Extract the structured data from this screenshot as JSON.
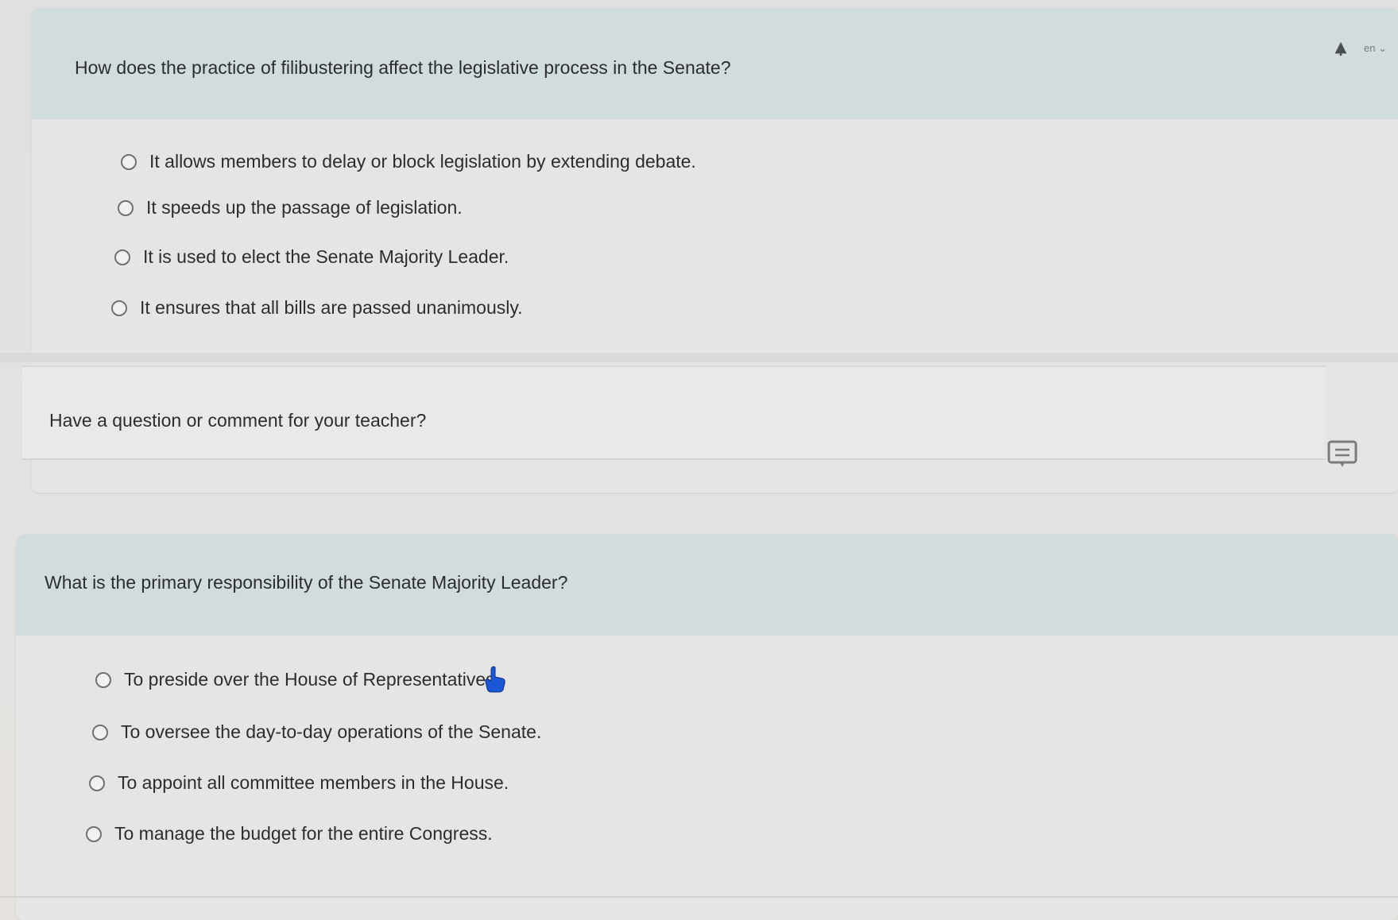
{
  "question1": {
    "text": "How does the practice of filibustering affect the legislative process in the Senate?",
    "options": [
      "It allows members to delay or block legislation by extending debate.",
      "It speeds up the passage of legislation.",
      "It is used to elect the Senate Majority Leader.",
      "It ensures that all bills are passed unanimously."
    ],
    "header_tools": {
      "alert_icon": "bell-icon",
      "language_label": "en"
    }
  },
  "comment": {
    "label": "Have a question or comment for your teacher?",
    "icon": "comment-icon"
  },
  "question2": {
    "text": "What is the primary responsibility of the Senate Majority Leader?",
    "options": [
      "To preside over the House of Representatives.",
      "To oversee the day-to-day operations of the Senate.",
      "To appoint all committee members in the House.",
      "To manage the budget for the entire Congress."
    ]
  },
  "cursor": {
    "icon": "hand-pointer-icon"
  },
  "colors": {
    "header_bg": "#d3dcdd",
    "card_bg": "#e5e6e4",
    "text": "#2b2d31",
    "cursor": "#1a56d6"
  }
}
